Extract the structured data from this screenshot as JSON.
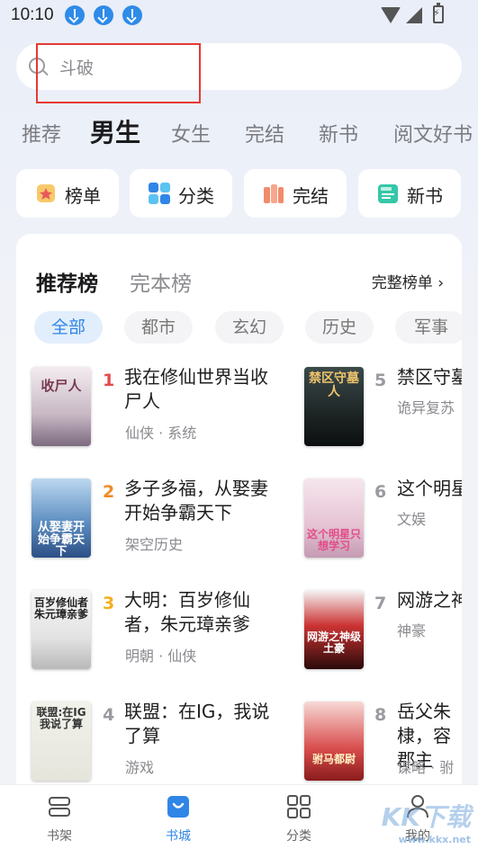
{
  "status": {
    "time": "10:10"
  },
  "search": {
    "text": "斗破"
  },
  "tabs": [
    "推荐",
    "男生",
    "女生",
    "完结",
    "新书",
    "阅文好书"
  ],
  "quick": [
    "榜单",
    "分类",
    "完结",
    "新书"
  ],
  "ranking": {
    "title_active": "推荐榜",
    "title_other": "完本榜",
    "full": "完整榜单 ›"
  },
  "chips": [
    "全部",
    "都市",
    "玄幻",
    "历史",
    "军事"
  ],
  "books": [
    {
      "rank": "1",
      "title": "我在修仙世界当收尸人",
      "tags": "仙侠 · 系统",
      "cover": "收尸人"
    },
    {
      "rank": "2",
      "title": "多子多福，从娶妻开始争霸天下",
      "tags": "架空历史",
      "cover": "从娶妻开始争霸天下"
    },
    {
      "rank": "3",
      "title": "大明：百岁修仙者，朱元璋亲爹",
      "tags": "明朝 · 仙侠",
      "cover": "百岁修仙者朱元璋亲爹"
    },
    {
      "rank": "4",
      "title": "联盟：在IG，我说了算",
      "tags": "游戏",
      "cover": "联盟:在IG我说了算"
    },
    {
      "rank": "5",
      "title": "禁区守墓人",
      "tags": "诡异复苏",
      "cover": "禁区守墓人"
    },
    {
      "rank": "6",
      "title": "这个明星",
      "tags": "文娱",
      "cover": "这个明星只想学习"
    },
    {
      "rank": "7",
      "title": "网游之神",
      "tags": "神豪",
      "cover": "网游之神级土豪"
    },
    {
      "rank": "8",
      "title": "岳父朱棣，容郡主",
      "tags": "谋略 · 驸",
      "cover": "驸马都尉"
    }
  ],
  "nav": [
    "书架",
    "书城",
    "分类",
    "我的"
  ],
  "watermark": {
    "main": "KK下载",
    "sub": "www.kkx.net"
  },
  "colors": {
    "accent": "#2f86e6",
    "rank1": "#e24c4c",
    "rank2": "#f08a24",
    "rank3": "#f2b01e",
    "rankOther": "#9a9aa0"
  }
}
